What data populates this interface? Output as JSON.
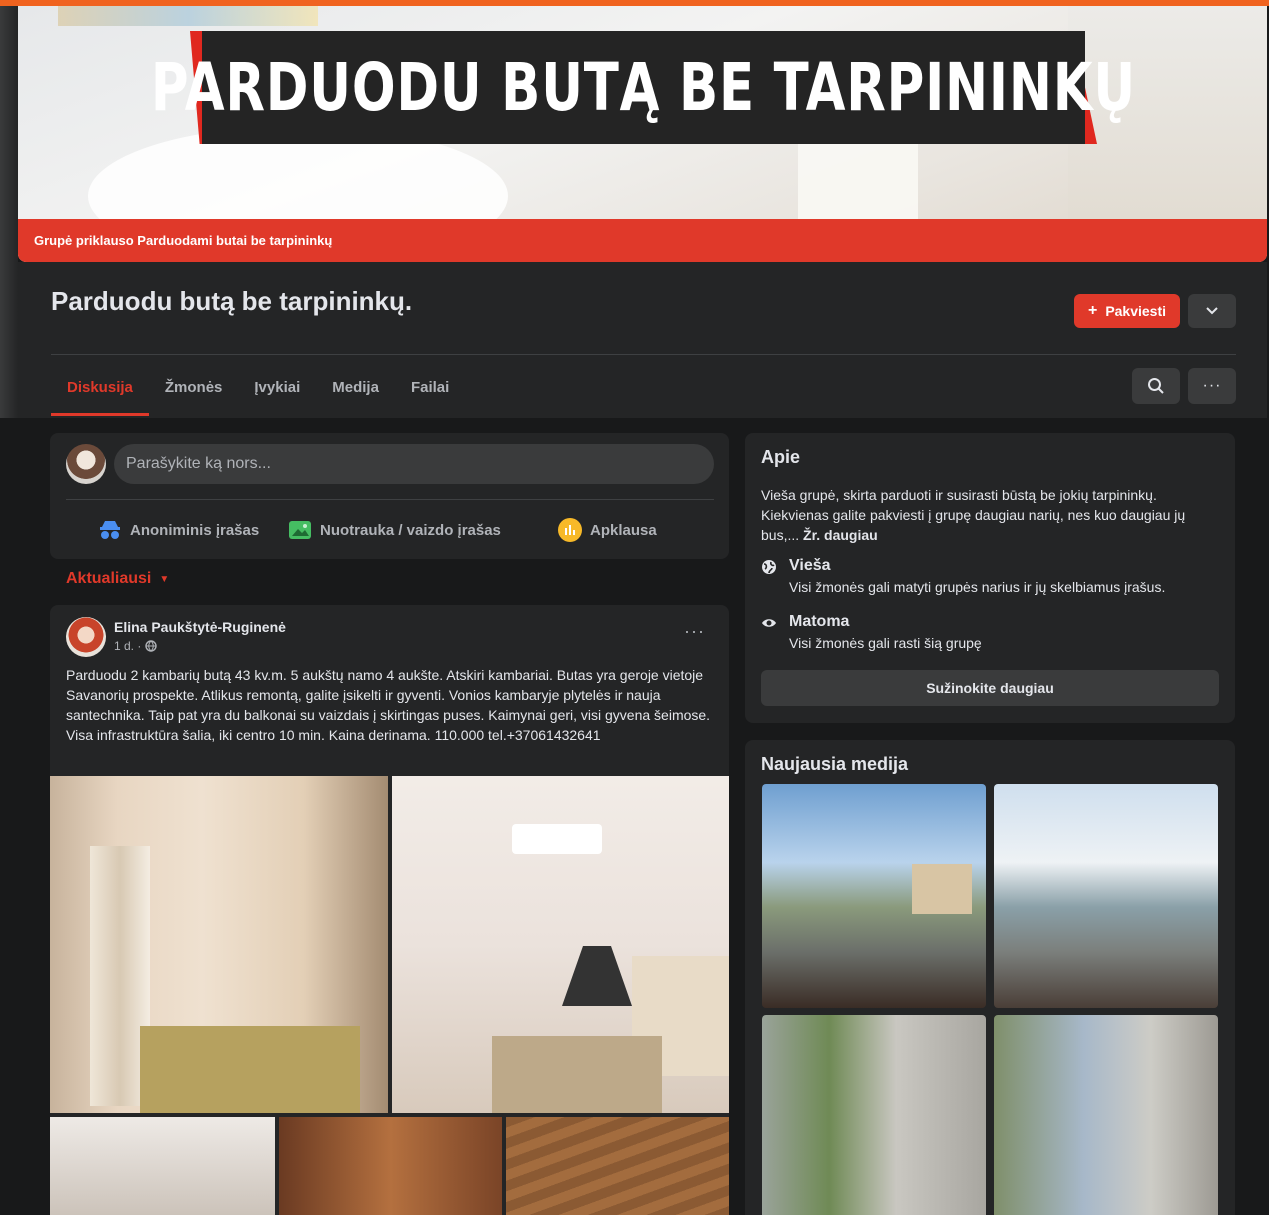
{
  "cover": {
    "banner_text": "PARDUODU BUTĄ BE TARPININKŲ",
    "footer_text": "Grupė priklauso Parduodami butai be tarpininkų"
  },
  "header": {
    "title": "Parduodu butą be tarpininkų.",
    "invite_label": "Pakviesti",
    "tabs": [
      {
        "label": "Diskusija",
        "active": true
      },
      {
        "label": "Žmonės"
      },
      {
        "label": "Įvykiai"
      },
      {
        "label": "Medija"
      },
      {
        "label": "Failai"
      }
    ]
  },
  "composer": {
    "placeholder": "Parašykite ką nors...",
    "actions": [
      "Anoniminis įrašas",
      "Nuotrauka / vaizdo įrašas",
      "Apklausa"
    ]
  },
  "feed": {
    "sort_label": "Aktualiausi"
  },
  "post": {
    "author": "Elina Paukštytė-Ruginenė",
    "time": "1 d. ·",
    "text": "Parduodu 2 kambarių butą 43 kv.m.  5 aukštų namo 4 aukšte.  Atskiri kambariai.  Butas yra geroje vietoje Savanorių prospekte.  Atlikus remontą, galite įsikelti ir gyventi.  Vonios kambaryje plytelės ir nauja santechnika.  Taip pat yra du balkonai su vaizdais į skirtingas puses.  Kaimynai geri, visi gyvena šeimose.  Visa infrastruktūra šalia, iki centro 10 min.  Kaina derinama.  110.000 tel.+37061432641"
  },
  "about": {
    "title": "Apie",
    "description": "Vieša grupė, skirta parduoti ir susirasti būstą be jokių tarpininkų. Kiekvienas galite pakviesti į grupę daugiau narių, nes kuo daugiau jų bus,...",
    "see_more": "Žr. daugiau",
    "privacy_title": "Vieša",
    "privacy_desc": "Visi žmonės gali matyti grupės narius ir jų skelbiamus įrašus.",
    "visibility_title": "Matoma",
    "visibility_desc": "Visi žmonės gali rasti šią grupę",
    "learn_more": "Sužinokite daugiau"
  },
  "media": {
    "title": "Naujausia medija"
  },
  "colors": {
    "accent": "#e0392a",
    "bg": "#18191a",
    "card": "#242526"
  }
}
